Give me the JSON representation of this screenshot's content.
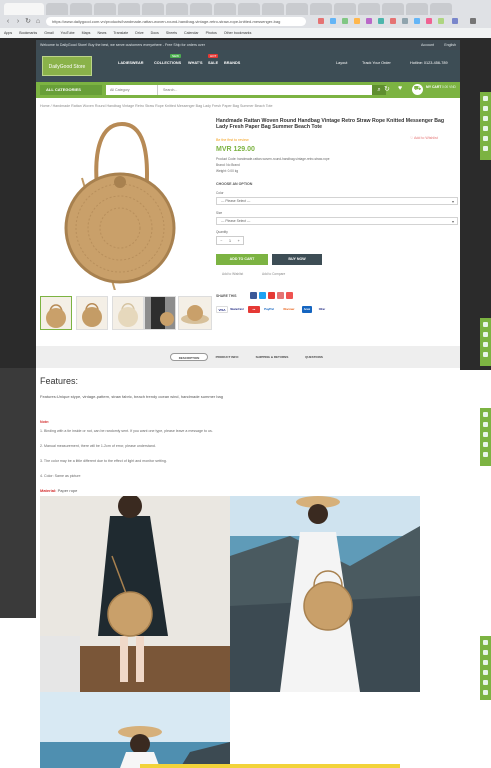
{
  "browser": {
    "url": "https://www.dailygood.com.vn/products/handmade-rattan-woven-round-handbag-vintage-retro-straw-rope-knitted-messenger-bag",
    "bookmarks": [
      "Apps",
      "Bookmarks",
      "Gmail",
      "YouTube",
      "Maps",
      "News",
      "Translate",
      "Drive",
      "Docs",
      "Sheets",
      "Calendar",
      "Photos",
      "Other bookmarks"
    ]
  },
  "site": {
    "topbar_text": "Welcome to DailyGood Store! Buy the best, we serve customers everywhere - Free Ship for orders over",
    "topbar_right": [
      "Account",
      "English"
    ],
    "logo_text": "DailyGood Store",
    "menu": [
      "LADIESWEAR",
      "COLLECTIONS",
      "WHAT'S",
      "SALE",
      "BRANDS"
    ],
    "menu_badges": [
      "NEW",
      "HOT"
    ],
    "header_links": [
      "Layout",
      "Track Your Order",
      "Hotline: 0123-456-789"
    ],
    "all_categories": "ALL CATEGORIES",
    "search_category": "All Category",
    "search_placeholder": "Search...",
    "cart_label": "MY CART",
    "cart_amount": "0.00 VND",
    "accent": "#7cb342",
    "dark": "#3d4d55"
  },
  "product": {
    "breadcrumb": "Home / Handmade Rattan Woven Round Handbag Vintage Retro Straw Rope Knitted Messenger Bag Lady Fresh Paper Bag Summer Beach Tote",
    "title": "Handmade Rattan Woven Round Handbag Vintage Retro Straw Rope Knitted Messenger Bag Lady Fresh Paper Bag Summer Beach Tote",
    "wishlist": "Add to Wishlist",
    "review": "Be the first to review",
    "price": "MVR 129.00",
    "info": [
      "Product Code: handmade-rattan-woven-round-handbag-vintage-retro-straw-rope",
      "Brand: No Brand",
      "Weight: 0.00 kg"
    ],
    "options_heading": "CHOOSE AN OPTION",
    "color_label": "Color",
    "color_placeholder": "--- Please Select ---",
    "size_label": "Size",
    "size_placeholder": "--- Please Select ---",
    "qty_label": "Quantity",
    "qty_value": "1",
    "add_to_cart": "ADD TO CART",
    "buy_now": "BUY NOW",
    "add_wishlist_small": "Add to Wishlist",
    "add_compare": "Add to Compare",
    "share_label": "SHARE THIS",
    "payments": [
      "VISA",
      "MasterCard",
      "PayPal",
      "Discover",
      "Amex",
      "Other"
    ]
  },
  "tabs": [
    "DESCRIPTION",
    "PRODUCT INFO",
    "SHIPPING & RETURNS",
    "QUESTIONS"
  ],
  "description": {
    "heading": "Features:",
    "features": "Features:Unique stype, vintage-pattern, straw fabric, beach trendy ocean wind, handmade summer bag",
    "note_heading": "Note:",
    "notes": [
      "1. Binding with a tie inside or not, can be randomly sent. If you want one type, please leave a message to us.",
      "2. Manual measurement, there will be 1-2cm of error, please understand.",
      "3. The color may be a little different due to the effect of light and monitor setting.",
      "4. Color: Same as picture"
    ],
    "material_label": "Material:",
    "material_value": "Paper rope"
  }
}
